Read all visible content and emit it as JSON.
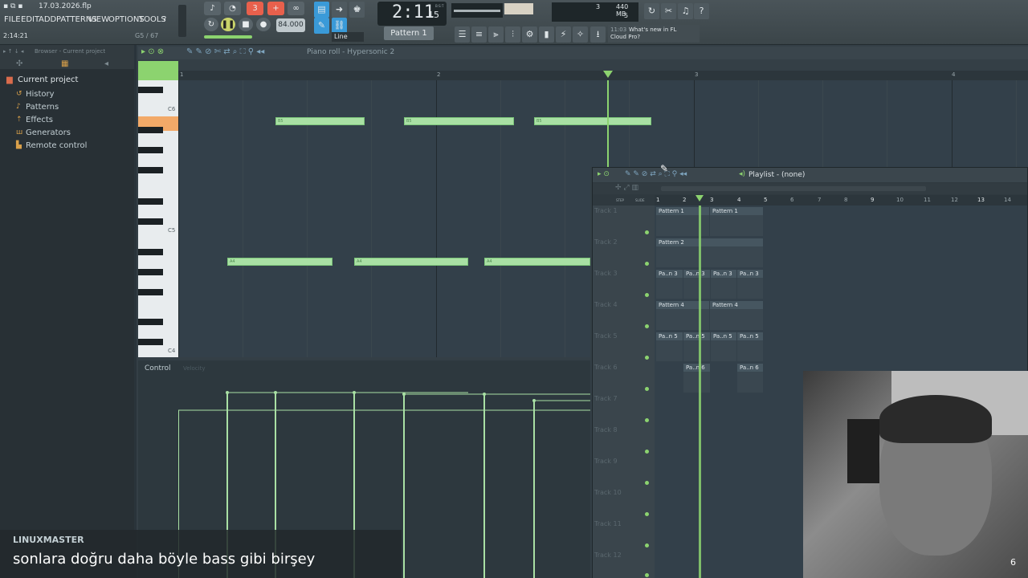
{
  "titlebar": {
    "filename": "17.03.2026.flp"
  },
  "menu": [
    "FILE",
    "EDIT",
    "ADD",
    "PATTERNS",
    "VIEW",
    "OPTIONS",
    "TOOLS",
    "?"
  ],
  "status": {
    "time_hint": "2:14:21",
    "gs": "G5 / 67"
  },
  "transport": {
    "tempo": "84.000",
    "time_display": "2:11",
    "time_sub": "15",
    "time_unit": "B:S:T",
    "pattern": "Pattern 1",
    "snap": "Line",
    "cpu_val": "3",
    "memory": "440 MB",
    "voices": "5"
  },
  "news": {
    "time": "11:03",
    "line1": "What's new in FL",
    "line2": "Cloud Pro?"
  },
  "browser": {
    "header": "Browser - Current project",
    "root": "Current project",
    "items": [
      "History",
      "Patterns",
      "Effects",
      "Generators",
      "Remote control"
    ]
  },
  "piano_roll": {
    "title": "Piano roll - Hypersonic 2",
    "ruler": [
      "1",
      "2",
      "3",
      "4"
    ],
    "keys": [
      "C6",
      "C5",
      "C4"
    ],
    "notes_top_label": "B5",
    "notes_low_label": "A4",
    "control_label": "Control",
    "control_sub": "Velocity"
  },
  "playlist": {
    "title": "Playlist - (none)",
    "ruler": [
      "1",
      "2",
      "3",
      "4",
      "5",
      "6",
      "7",
      "8",
      "9",
      "10",
      "11",
      "12",
      "13",
      "14"
    ],
    "step_label": "STEP",
    "slide_label": "SLIDE",
    "tracks": [
      "Track 1",
      "Track 2",
      "Track 3",
      "Track 4",
      "Track 5",
      "Track 6",
      "Track 7",
      "Track 8",
      "Track 9",
      "Track 10",
      "Track 11",
      "Track 12"
    ],
    "clips": {
      "p1": "Pattern 1",
      "p2": "Pattern 2",
      "p3": "Pa..n 3",
      "p4": "Pattern 4",
      "p5": "Pa..n 5",
      "p6": "Pa..n 6"
    }
  },
  "caption": {
    "user": "LINUXMASTER",
    "message": "sonlara doğru daha böyle bass gibi birşey"
  },
  "webcam": {
    "badge": "6"
  },
  "colors": {
    "note": "#a9e0a4",
    "playhead": "#8cd36f",
    "accent_pattern": "#e8604c"
  }
}
